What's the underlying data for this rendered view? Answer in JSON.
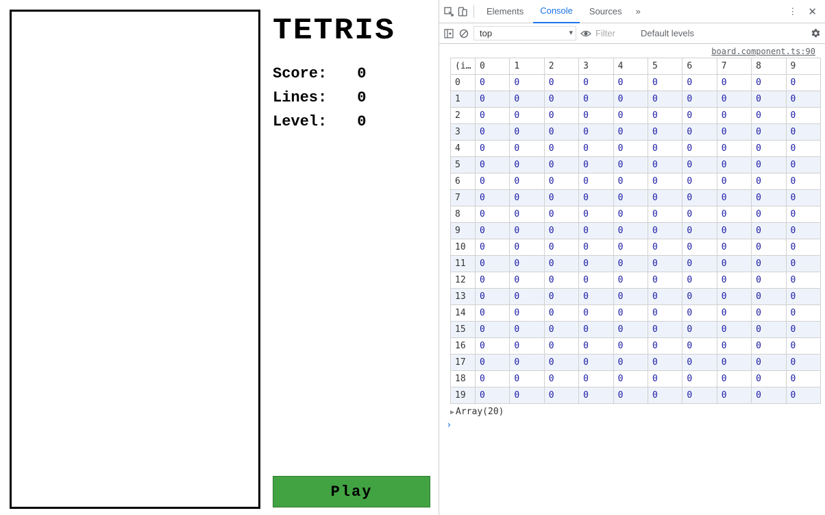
{
  "game": {
    "title": "TETRIS",
    "score_label": "Score:",
    "score_value": "0",
    "lines_label": "Lines:",
    "lines_value": "0",
    "level_label": "Level:",
    "level_value": "0",
    "play_label": "Play"
  },
  "devtools": {
    "tabs": {
      "elements": "Elements",
      "console": "Console",
      "sources": "Sources",
      "more": "»"
    },
    "toolbar": {
      "context": "top",
      "filter_placeholder": "Filter",
      "levels": "Default levels"
    },
    "source_link": "board.component.ts:90",
    "table": {
      "index_header": "(i…",
      "col_headers": [
        "0",
        "1",
        "2",
        "3",
        "4",
        "5",
        "6",
        "7",
        "8",
        "9"
      ],
      "rows": [
        {
          "idx": "0",
          "cells": [
            "0",
            "0",
            "0",
            "0",
            "0",
            "0",
            "0",
            "0",
            "0",
            "0"
          ]
        },
        {
          "idx": "1",
          "cells": [
            "0",
            "0",
            "0",
            "0",
            "0",
            "0",
            "0",
            "0",
            "0",
            "0"
          ]
        },
        {
          "idx": "2",
          "cells": [
            "0",
            "0",
            "0",
            "0",
            "0",
            "0",
            "0",
            "0",
            "0",
            "0"
          ]
        },
        {
          "idx": "3",
          "cells": [
            "0",
            "0",
            "0",
            "0",
            "0",
            "0",
            "0",
            "0",
            "0",
            "0"
          ]
        },
        {
          "idx": "4",
          "cells": [
            "0",
            "0",
            "0",
            "0",
            "0",
            "0",
            "0",
            "0",
            "0",
            "0"
          ]
        },
        {
          "idx": "5",
          "cells": [
            "0",
            "0",
            "0",
            "0",
            "0",
            "0",
            "0",
            "0",
            "0",
            "0"
          ]
        },
        {
          "idx": "6",
          "cells": [
            "0",
            "0",
            "0",
            "0",
            "0",
            "0",
            "0",
            "0",
            "0",
            "0"
          ]
        },
        {
          "idx": "7",
          "cells": [
            "0",
            "0",
            "0",
            "0",
            "0",
            "0",
            "0",
            "0",
            "0",
            "0"
          ]
        },
        {
          "idx": "8",
          "cells": [
            "0",
            "0",
            "0",
            "0",
            "0",
            "0",
            "0",
            "0",
            "0",
            "0"
          ]
        },
        {
          "idx": "9",
          "cells": [
            "0",
            "0",
            "0",
            "0",
            "0",
            "0",
            "0",
            "0",
            "0",
            "0"
          ]
        },
        {
          "idx": "10",
          "cells": [
            "0",
            "0",
            "0",
            "0",
            "0",
            "0",
            "0",
            "0",
            "0",
            "0"
          ]
        },
        {
          "idx": "11",
          "cells": [
            "0",
            "0",
            "0",
            "0",
            "0",
            "0",
            "0",
            "0",
            "0",
            "0"
          ]
        },
        {
          "idx": "12",
          "cells": [
            "0",
            "0",
            "0",
            "0",
            "0",
            "0",
            "0",
            "0",
            "0",
            "0"
          ]
        },
        {
          "idx": "13",
          "cells": [
            "0",
            "0",
            "0",
            "0",
            "0",
            "0",
            "0",
            "0",
            "0",
            "0"
          ]
        },
        {
          "idx": "14",
          "cells": [
            "0",
            "0",
            "0",
            "0",
            "0",
            "0",
            "0",
            "0",
            "0",
            "0"
          ]
        },
        {
          "idx": "15",
          "cells": [
            "0",
            "0",
            "0",
            "0",
            "0",
            "0",
            "0",
            "0",
            "0",
            "0"
          ]
        },
        {
          "idx": "16",
          "cells": [
            "0",
            "0",
            "0",
            "0",
            "0",
            "0",
            "0",
            "0",
            "0",
            "0"
          ]
        },
        {
          "idx": "17",
          "cells": [
            "0",
            "0",
            "0",
            "0",
            "0",
            "0",
            "0",
            "0",
            "0",
            "0"
          ]
        },
        {
          "idx": "18",
          "cells": [
            "0",
            "0",
            "0",
            "0",
            "0",
            "0",
            "0",
            "0",
            "0",
            "0"
          ]
        },
        {
          "idx": "19",
          "cells": [
            "0",
            "0",
            "0",
            "0",
            "0",
            "0",
            "0",
            "0",
            "0",
            "0"
          ]
        }
      ]
    },
    "array_summary": "Array(20)",
    "prompt": "›"
  }
}
